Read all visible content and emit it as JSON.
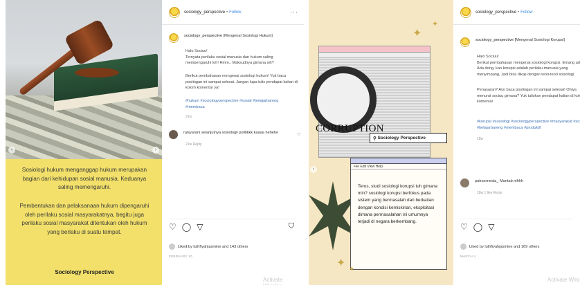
{
  "left_post": {
    "username": "sociology_perspective",
    "follow": "Follow",
    "caption_title": "[Mengenal Sosiologi Hukum]",
    "caption_lines": [
      "Halo Sociuu!",
      "Ternyata perilaku sosial manusia dan hukum saling",
      "mempengaruhi loh! Hmm.. Maksudnya gimana sih?"
    ],
    "caption_lines2": [
      "Berikut pembahasan mengenai sosiologi hukum! Yuk baca",
      "postingan ini sampai selesai. Jangan lupa tulis pendapat kalian di",
      "kolom komentar ya!"
    ],
    "hashtags": [
      "#hukum #sociologyperspective #sosial #belajarbareng",
      "#membaca"
    ],
    "caption_time": "21w",
    "comment_user": "raisyarani",
    "comment_text": "selanjutnya sosiologii politikkk kaaaa hehehe",
    "comment_meta": "21w  Reply",
    "liked_by": "Liked by luthfiyahjasmine and 143 others",
    "date": "FEBRUARY 10",
    "image_text": [
      "Sosiologi hukum menganggap hukum merupakan",
      "bagian dari kehidupan sosial manusia. Keduanya",
      "saling memengaruhi."
    ],
    "image_text2": [
      "Pembentukan dan pelaksanaan hukum dipengaruhi",
      "oleh perilaku sosial masyarakatnya, begitu juga",
      "perilaku sosial masyarakat ditentukan oleh hukum",
      "yang berlaku di suatu tempat."
    ],
    "image_brand": "Sociology Perspective",
    "watermark": "Activate Window"
  },
  "right_post": {
    "username": "sociology_perspective",
    "follow": "Follow",
    "caption_title": "[Mengenal Sosiologi Korupsi]",
    "caption_lines": [
      "Halo Sociuu!",
      "Berikut pembahasan mengenai sosiologi korupsi. Emang ada ya?",
      "Ada dong, kan korupsi adalah perilaku manusia yang",
      "menyimpang, Jadi bisa dikaji dengan teori-teori sosiologi."
    ],
    "caption_lines2": [
      "Penasaran? Ayo baca postingan ini sampai selesai! Ohiya",
      "menurut sociuu gimana? Yuk tuliskan pendapat kalian di kolom",
      "komentar."
    ],
    "hashtags": [
      "#korupsi #sosiologi #sociologyperspective #masyarakat #sosial",
      "#belajarbareng #membaca #produktif"
    ],
    "caption_time": "18w",
    "comment_user": "putraernesta_",
    "comment_text": "Mantab nihhh",
    "comment_meta": "18w  1 like  Reply",
    "liked_by": "Liked by luthfiyahjasmine and 169 others",
    "date": "MARCH 4",
    "image_corruption": "CORRUPTION",
    "image_search": "Sociology Perspective",
    "image_menu": "File Edit View Help",
    "image_text": [
      "Terus, studi sosiologi korupsi tuh gimana",
      "min? sosiologi korupsi berfokus pada",
      "sistem yang bermasalah dan berkaitan",
      "dengan kondisi kemiskinan, eksploitasi",
      "dimana permasalahan ini umumnya",
      "terjadi di negara berkembang."
    ],
    "watermark": "Activate Windo"
  },
  "icons": {
    "heart": "♡",
    "comment": "◯",
    "share": "▽",
    "bookmark": "⛉",
    "more": "···"
  }
}
